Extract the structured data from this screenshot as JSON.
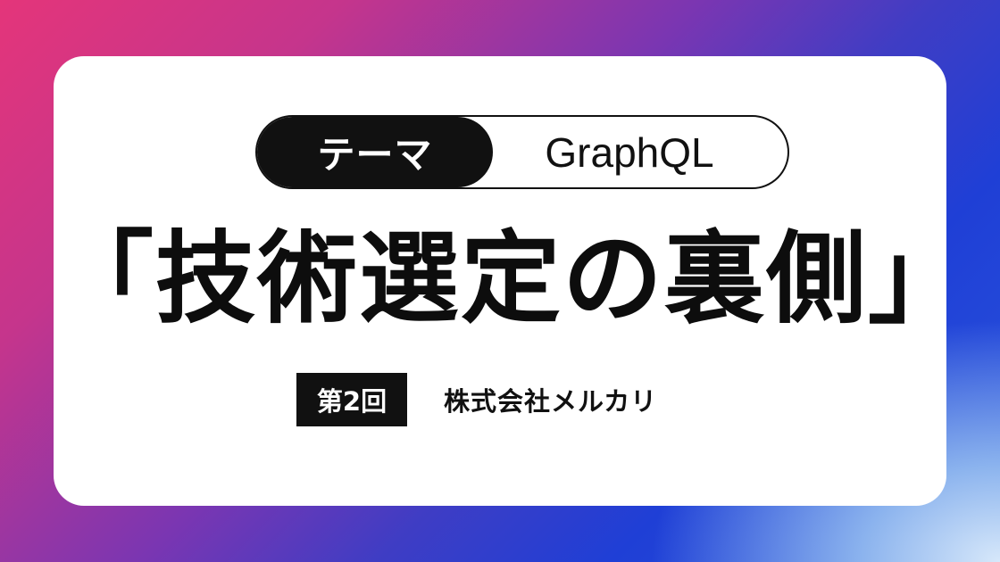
{
  "theme": {
    "label": "テーマ",
    "value": "GraphQL"
  },
  "title": "「技術選定の裏側」",
  "episode": "第2回",
  "company": "株式会社メルカリ",
  "colors": {
    "gradient_start": "#e4357a",
    "gradient_mid": "#7a36b2",
    "gradient_end": "#1f3fd6",
    "card": "#ffffff",
    "text": "#111111"
  }
}
